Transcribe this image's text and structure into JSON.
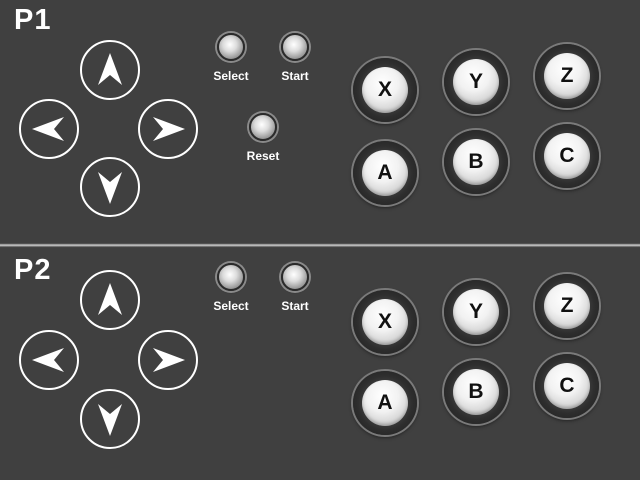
{
  "players": [
    {
      "label": "P1",
      "small_buttons": [
        {
          "id": "select",
          "label": "Select"
        },
        {
          "id": "start",
          "label": "Start"
        },
        {
          "id": "reset",
          "label": "Reset"
        }
      ],
      "face_buttons": [
        "X",
        "Y",
        "Z",
        "A",
        "B",
        "C"
      ]
    },
    {
      "label": "P2",
      "small_buttons": [
        {
          "id": "select",
          "label": "Select"
        },
        {
          "id": "start",
          "label": "Start"
        }
      ],
      "face_buttons": [
        "X",
        "Y",
        "Z",
        "A",
        "B",
        "C"
      ]
    }
  ],
  "colors": {
    "panel": "#404040",
    "outline": "#ffffff",
    "button_cap": "#f2f2f2",
    "button_letter": "#111111"
  },
  "icons": [
    "up-arrow-icon",
    "left-arrow-icon",
    "right-arrow-icon",
    "down-arrow-icon"
  ]
}
